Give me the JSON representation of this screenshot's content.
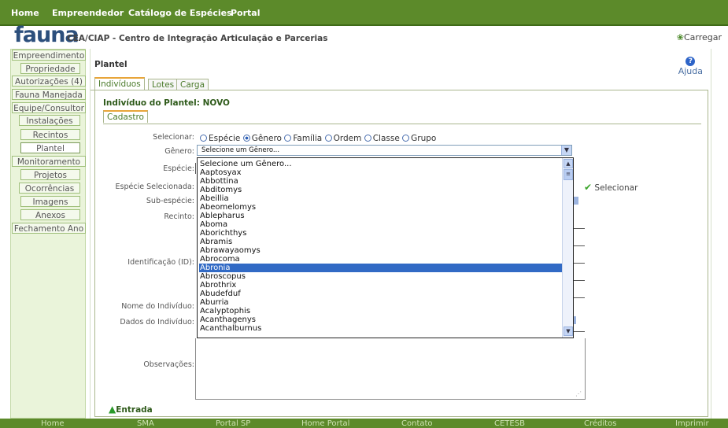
{
  "nav": {
    "items": [
      "Home",
      "Empreendedor",
      "Catálogo de Espécies",
      "Portal"
    ]
  },
  "header": {
    "logo": "fauna",
    "org": "CEA/CIAP - Centro de Integração Articulação e Parcerias",
    "carregar": "Carregar"
  },
  "sidebar": {
    "items": [
      "Empreendimento",
      "Propriedade",
      "Autorizações (4)",
      "Fauna Manejada",
      "Equipe/Consultor",
      "Instalações",
      "Recintos",
      "Plantel",
      "Monitoramento",
      "Projetos",
      "Ocorrências",
      "Imagens",
      "Anexos",
      "Fechamento Ano"
    ]
  },
  "content": {
    "title": "Plantel",
    "help": "Ajuda",
    "tabs": [
      "Indivíduos",
      "Lotes",
      "Carga"
    ],
    "individuo_title": "Indivíduo do Plantel: NOVO",
    "subtab": "Cadastro"
  },
  "form": {
    "labels": {
      "selecionar": "Selecionar:",
      "genero": "Gênero:",
      "especie": "Espécie:",
      "especie_selecionada": "Espécie Selecionada:",
      "subespecie": "Sub-espécie:",
      "recinto": "Recinto:",
      "identificacao": "Identificação (ID):",
      "nome": "Nome do Indivíduo:",
      "dados": "Dados do Indivíduo:",
      "observacoes": "Observações:"
    },
    "radio_options": [
      "Espécie",
      "Gênero",
      "Família",
      "Ordem",
      "Classe",
      "Grupo"
    ],
    "radio_selected": "Gênero",
    "genero_value": "Selecione um Gênero...",
    "dropdown_options": [
      "Selecione um Gênero...",
      "Aaptosyax",
      "Abbottina",
      "Abditomys",
      "Abeillia",
      "Abeomelomys",
      "Ablepharus",
      "Aboma",
      "Aborichthys",
      "Abramis",
      "Abrawayaomys",
      "Abrocoma",
      "Abronia",
      "Abroscopus",
      "Abrothrix",
      "Abudefduf",
      "Aburria",
      "Acalyptophis",
      "Acanthagenys",
      "Acanthalburnus"
    ],
    "dropdown_selected": "Abronia",
    "selecionar_btn": "Selecionar",
    "entrada": "Entrada"
  },
  "footer": {
    "links": [
      "Home",
      "SMA",
      "Portal SP",
      "Home Portal",
      "Contato",
      "CETESB",
      "Créditos",
      "Imprimir"
    ]
  },
  "colors": {
    "nav_bg": "#5c8a2a",
    "menu_bg": "#eaf4da",
    "selection": "#316ac5"
  }
}
